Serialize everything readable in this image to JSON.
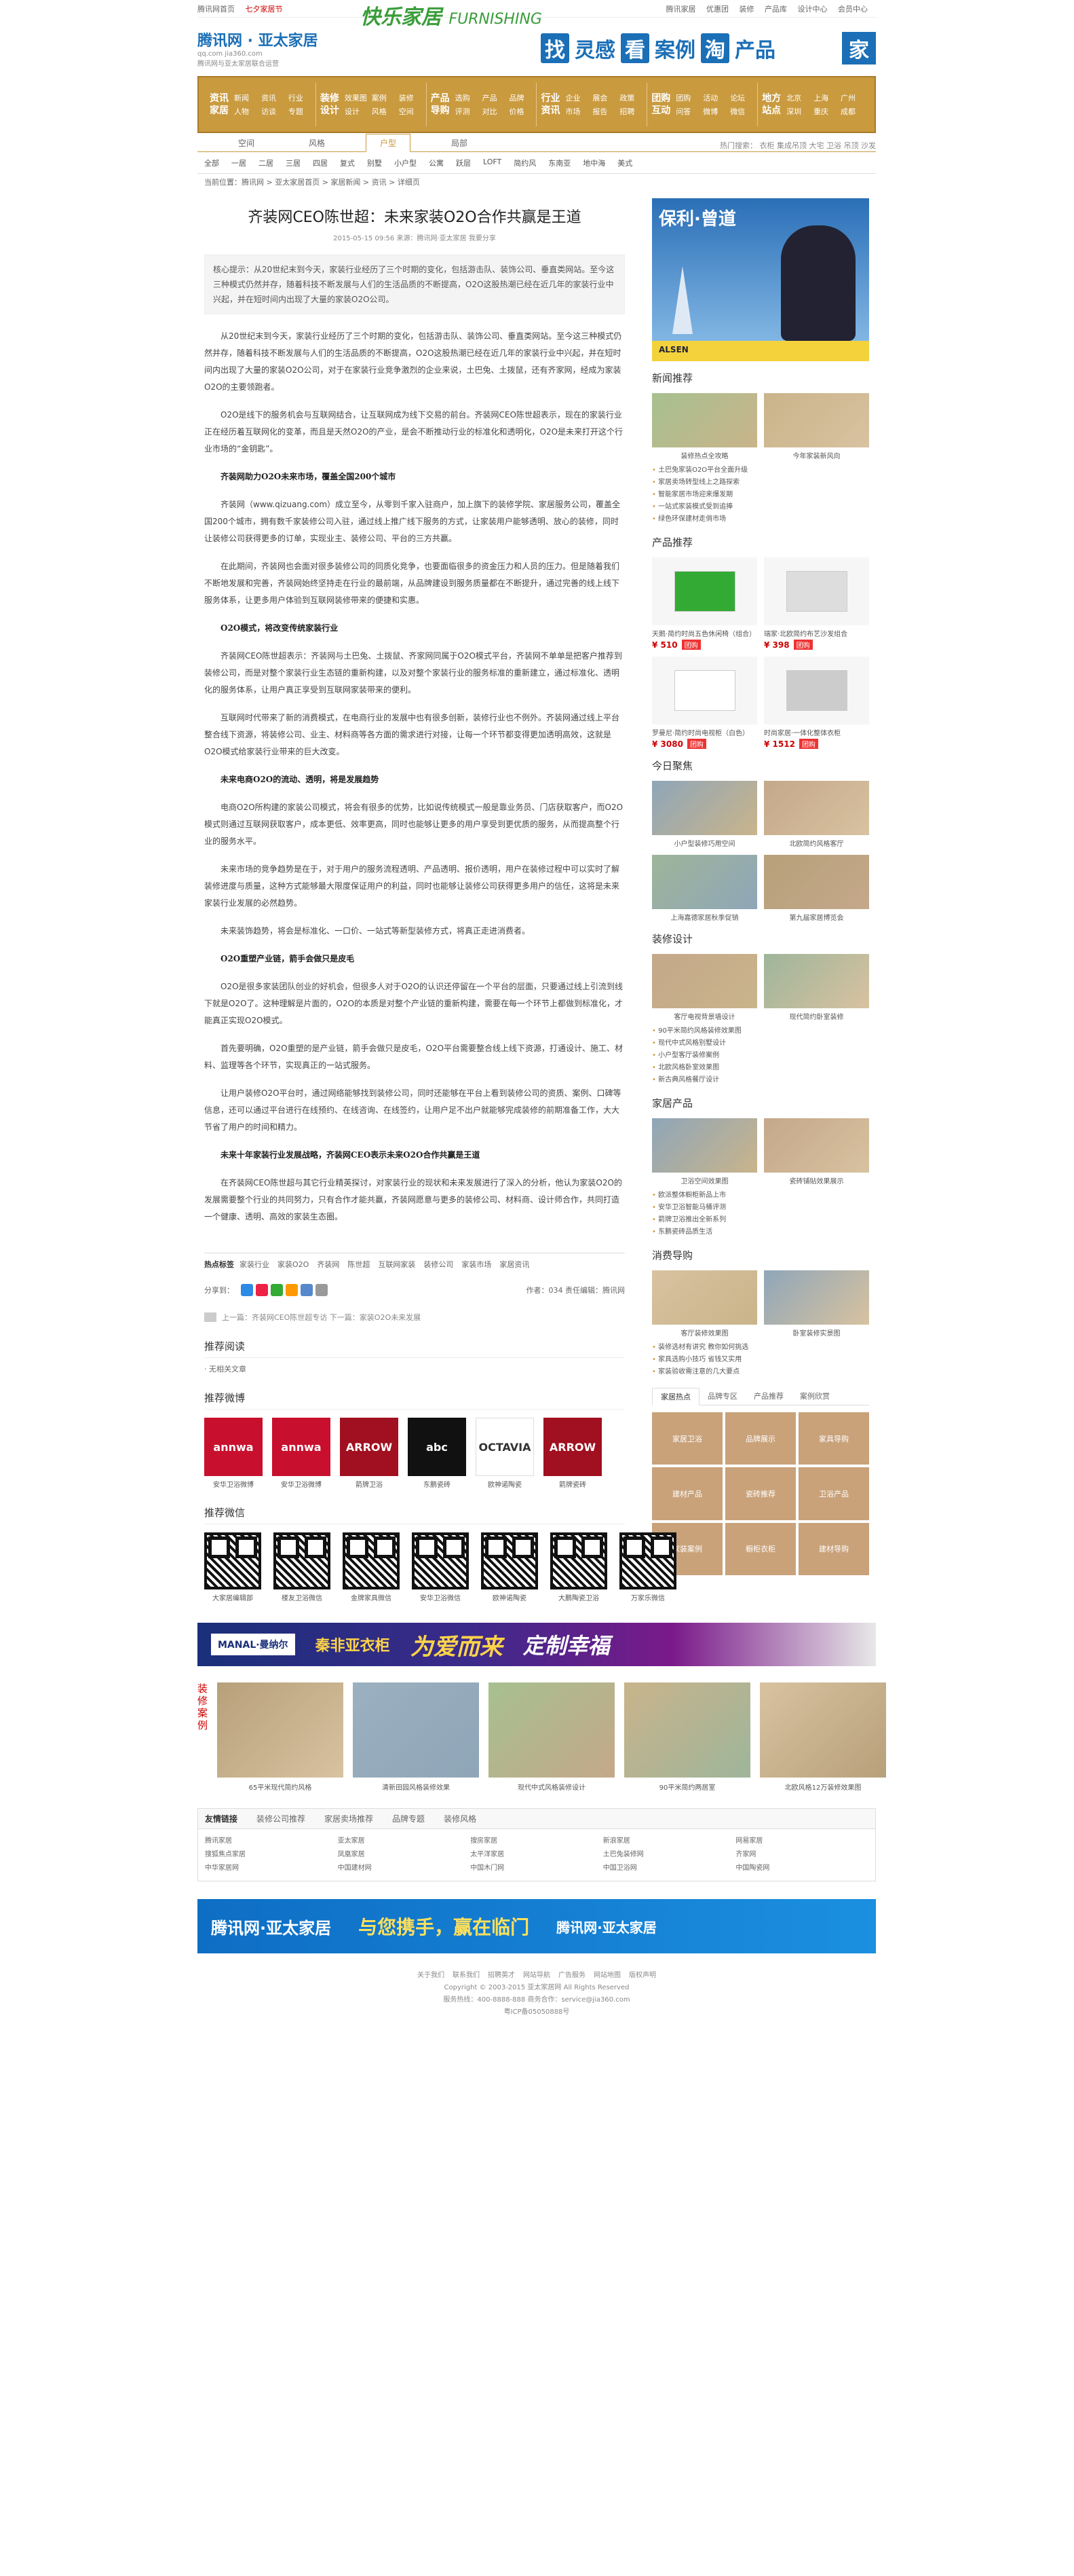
{
  "topbar": {
    "left": [
      "腾讯网首页",
      "七夕家居节"
    ],
    "slogan": "快乐家居",
    "slogan_en": "FURNISHING",
    "right": [
      "腾讯家居",
      "优惠团",
      "装修",
      "产品库",
      "设计中心",
      "会员中心"
    ]
  },
  "header": {
    "brand": "腾讯网 · 亚太家居",
    "brand_url": "qq.com  jia360.com",
    "sub": "腾讯网与亚太家居联合运营",
    "slogan_parts": [
      "找",
      "灵感",
      "看",
      "案例",
      "淘",
      "产品"
    ],
    "jia": "家"
  },
  "nav": [
    {
      "title": "资讯 家居",
      "links": [
        "新闻",
        "资讯",
        "行业",
        "人物",
        "访谈",
        "专题"
      ]
    },
    {
      "title": "装修 设计",
      "links": [
        "效果图",
        "案例",
        "装修",
        "设计",
        "风格",
        "空间"
      ]
    },
    {
      "title": "产品 导购",
      "links": [
        "选购",
        "产品",
        "品牌",
        "评测",
        "对比",
        "价格"
      ]
    },
    {
      "title": "行业 资讯",
      "links": [
        "企业",
        "展会",
        "政策",
        "市场",
        "报告",
        "招聘"
      ]
    },
    {
      "title": "团购 互动",
      "links": [
        "团购",
        "活动",
        "论坛",
        "问答",
        "微博",
        "微信"
      ]
    },
    {
      "title": "地方 站点",
      "links": [
        "北京",
        "上海",
        "广州",
        "深圳",
        "重庆",
        "成都"
      ]
    }
  ],
  "subnav": {
    "tabs": [
      "空间",
      "风格",
      "户型",
      "局部"
    ],
    "active_tab": "户型",
    "links": [
      "全部",
      "一居",
      "二居",
      "三居",
      "四居",
      "复式",
      "别墅",
      "小户型",
      "公寓",
      "跃层",
      "LOFT",
      "简约风",
      "东南亚",
      "地中海",
      "美式"
    ],
    "right": "热门搜索：  衣柜 集成吊顶 大宅 卫浴 吊顶 沙发"
  },
  "breadcrumb": "当前位置：腾讯网 > 亚太家居首页 > 家居新闻 > 资讯 > 详细页",
  "article": {
    "title": "齐装网CEO陈世超：未来家装O2O合作共赢是王道",
    "meta": "2015-05-15 09:56   来源：腾讯网·亚太家居   我要分享",
    "summary": "核心提示：从20世纪末到今天，家装行业经历了三个时期的变化，包括游击队、装饰公司、垂直类网站。至今这三种模式仍然并存，随着科技不断发展与人们的生活品质的不断提高，O2O这股热潮已经在近几年的家装行业中兴起，并在短时间内出现了大量的家装O2O公司。",
    "paragraphs": [
      {
        "sub": false,
        "text": "从20世纪末到今天，家装行业经历了三个时期的变化，包括游击队、装饰公司、垂直类网站。至今这三种模式仍然并存，随着科技不断发展与人们的生活品质的不断提高，O2O这股热潮已经在近几年的家装行业中兴起，并在短时间内出现了大量的家装O2O公司，对于在家装行业竞争激烈的企业来说，土巴兔、土拨鼠，还有齐家网，经成为家装O2O的主要领跑者。"
      },
      {
        "sub": false,
        "text": "O2O是线下的服务机会与互联网结合，让互联网成为线下交易的前台。齐装网CEO陈世超表示，现在的家装行业正在经历着互联网化的变革，而且是天然O2O的产业，是会不断推动行业的标准化和透明化，O2O是未来打开这个行业市场的“金钥匙”。"
      },
      {
        "sub": true,
        "text": "齐装网助力O2O未来市场，覆盖全国200个城市"
      },
      {
        "sub": false,
        "text": "齐装网（www.qizuang.com）成立至今，从零到千家入驻商户，加上旗下的装修学院、家居服务公司，覆盖全国200个城市，拥有数千家装修公司入驻，通过线上推广线下服务的方式，让家装用户能够透明、放心的装修，同时让装修公司获得更多的订单，实现业主、装修公司、平台的三方共赢。"
      },
      {
        "sub": false,
        "text": "在此期间，齐装网也会面对很多装修公司的同质化竞争，也要面临很多的资金压力和人员的压力。但是随着我们不断地发展和完善，齐装网始终坚持走在行业的最前端，从品牌建设到服务质量都在不断提升，通过完善的线上线下服务体系，让更多用户体验到互联网装修带来的便捷和实惠。"
      },
      {
        "sub": true,
        "text": "O2O模式，将改变传统家装行业"
      },
      {
        "sub": false,
        "text": "齐装网CEO陈世超表示：齐装网与土巴兔、土拨鼠、齐家网同属于O2O模式平台，齐装网不单单是把客户推荐到装修公司，而是对整个家装行业生态链的重新构建，以及对整个家装行业的服务标准的重新建立，通过标准化、透明化的服务体系，让用户真正享受到互联网家装带来的便利。"
      },
      {
        "sub": false,
        "text": "互联网时代带来了新的消费模式，在电商行业的发展中也有很多创新，装修行业也不例外。齐装网通过线上平台整合线下资源，将装修公司、业主、材料商等各方面的需求进行对接，让每一个环节都变得更加透明高效，这就是O2O模式给家装行业带来的巨大改变。"
      },
      {
        "sub": true,
        "text": "未来电商O2O的流动、透明，将是发展趋势"
      },
      {
        "sub": false,
        "text": "电商O2O所构建的家装公司模式，将会有很多的优势，比如说传统模式一般是靠业务员、门店获取客户，而O2O模式则通过互联网获取客户，成本更低、效率更高，同时也能够让更多的用户享受到更优质的服务，从而提高整个行业的服务水平。"
      },
      {
        "sub": false,
        "text": "未来市场的竞争趋势是在于，对于用户的服务流程透明、产品透明、报价透明，用户在装修过程中可以实时了解装修进度与质量，这种方式能够最大限度保证用户的利益，同时也能够让装修公司获得更多用户的信任，这将是未来家装行业发展的必然趋势。"
      },
      {
        "sub": false,
        "text": "未来装饰趋势，将会是标准化、一口价、一站式等新型装修方式，将真正走进消费者。"
      },
      {
        "sub": true,
        "text": "O2O重塑产业链，箭手会做只是皮毛"
      },
      {
        "sub": false,
        "text": "O2O是很多家装团队创业的好机会，但很多人对于O2O的认识还停留在一个平台的层面，只要通过线上引流到线下就是O2O了。这种理解是片面的，O2O的本质是对整个产业链的重新构建，需要在每一个环节上都做到标准化，才能真正实现O2O模式。"
      },
      {
        "sub": false,
        "text": "首先要明确，O2O重塑的是产业链，箭手会做只是皮毛，O2O平台需要整合线上线下资源，打通设计、施工、材料、监理等各个环节，实现真正的一站式服务。"
      },
      {
        "sub": false,
        "text": "让用户装修O2O平台时，通过网络能够找到装修公司，同时还能够在平台上看到装修公司的资质、案例、口碑等信息，还可以通过平台进行在线预约、在线咨询、在线签约，让用户足不出户就能够完成装修的前期准备工作，大大节省了用户的时间和精力。"
      },
      {
        "sub": true,
        "text": "未来十年家装行业发展战略，齐装网CEO表示未来O2O合作共赢是王道"
      },
      {
        "sub": false,
        "text": "在齐装网CEO陈世超与其它行业精英探讨，对家装行业的现状和未来发展进行了深入的分析，他认为家装O2O的发展需要整个行业的共同努力，只有合作才能共赢，齐装网愿意与更多的装修公司、材料商、设计师合作，共同打造一个健康、透明、高效的家装生态圈。"
      }
    ],
    "tags_label": "热点标签",
    "tags": [
      "家装行业",
      "家装O2O",
      "齐装网",
      "陈世超",
      "互联网家装",
      "装修公司",
      "家装市场",
      "家居资讯"
    ],
    "share_label": "分享到：",
    "share_right": "作者：034   责任编辑：腾讯网",
    "prevnext": "上一篇：齐装网CEO陈世超专访  下一篇：家装O2O未来发展",
    "rec_news_title": "推荐阅读",
    "rec_news_item": "· 无相关文章",
    "weibo_title": "推荐微博",
    "weibo": [
      {
        "name": "annwa",
        "sub": "安华卫浴微博",
        "color": "#c8102e"
      },
      {
        "name": "annwa",
        "sub": "安华卫浴微博",
        "color": "#c8102e"
      },
      {
        "name": "ARROW",
        "sub": "箭牌卫浴",
        "color": "#a01020"
      },
      {
        "name": "abc",
        "sub": "东鹏瓷砖",
        "color": "#111111"
      },
      {
        "name": "OCTAVIA",
        "sub": "欧神诺陶瓷",
        "color": "#ffffff"
      },
      {
        "name": "ARROW",
        "sub": "箭牌瓷砖",
        "color": "#a01020"
      }
    ],
    "wechat_title": "推荐微信",
    "wechat": [
      "大家居编辑部",
      "楼友卫浴微信",
      "金牌家具微信",
      "安华卫浴微信",
      "欧神诺陶瓷",
      "大鹏陶瓷卫浴",
      "万家乐微信"
    ]
  },
  "side": {
    "ad_title": "保利·曾道",
    "ad_bar": "ALSEN",
    "news_title": "新闻推荐",
    "news_thumbs": [
      "装修热点全攻略",
      "今年家装新风向"
    ],
    "news_list": [
      "土巴兔家装O2O平台全面升级",
      "家居卖场转型线上之路探索",
      "智能家居市场迎来爆发期",
      "一站式家装模式受到追捧",
      "绿色环保建材走俏市场"
    ],
    "prod_title": "产品推荐",
    "products": [
      {
        "name": "天鹅·简约时尚五色休闲椅（组合）",
        "price": "¥ 510",
        "badge": "团购"
      },
      {
        "name": "瑞家·北欧简约布艺沙发组合",
        "price": "¥ 398",
        "badge": "团购"
      },
      {
        "name": "罗曼尼·简约时尚电视柜（白色）",
        "price": "¥ 3080",
        "badge": "团购"
      },
      {
        "name": "时尚家居·一体化整体衣柜",
        "price": "¥ 1512",
        "badge": "团购"
      }
    ],
    "today_title": "今日聚焦",
    "today": [
      "小户型装修巧用空间",
      "北欧简约风格客厅",
      "上海嘉德家居秋季促销",
      "第九届家居博览会"
    ],
    "design_title": "装修设计",
    "design": [
      "客厅电视背景墙设计",
      "现代简约卧室装修"
    ],
    "design_list": [
      "90平米简约风格装修效果图",
      "现代中式风格别墅设计",
      "小户型客厅装修案例",
      "北欧风格卧室效果图",
      "新古典风格餐厅设计"
    ],
    "brand_title": "家居产品",
    "brand": [
      "卫浴空间效果图",
      "瓷砖铺贴效果展示"
    ],
    "brand_list": [
      "欧派整体橱柜新品上市",
      "安华卫浴智能马桶评测",
      "箭牌卫浴推出全新系列",
      "东鹏瓷砖品质生活"
    ],
    "shop_title": "消费导购",
    "shop": [
      "客厅装修效果图",
      "卧室装修实景图"
    ],
    "shop_list": [
      "装修选材有讲究 教你如何挑选",
      "家具选购小技巧 省钱又实用",
      "家装验收需注意的几大要点"
    ],
    "tabs": [
      "家居热点",
      "品牌专区",
      "产品推荐",
      "案例欣赏"
    ],
    "grid": [
      "家居卫浴",
      "品牌展示",
      "家具导购",
      "建材产品",
      "瓷砖推荐",
      "卫浴产品",
      "家装案例",
      "橱柜衣柜",
      "建材导购"
    ]
  },
  "banner": {
    "b1": "MANAL·曼纳尔",
    "b2": "秦非亚衣柜",
    "b3": "为爱而来",
    "b4": "定制幸福"
  },
  "gallery": {
    "label": "装修案例",
    "items": [
      "65平米现代简约风格",
      "清新田园风格装修效果",
      "现代中式风格装修设计",
      "90平米简约两居室",
      "北欧风格12万装修效果图"
    ]
  },
  "friends": {
    "tabs": [
      "友情链接",
      "装修公司推荐",
      "家居卖场推荐",
      "品牌专题",
      "装修风格"
    ],
    "links": [
      "腾讯家居",
      "亚太家居",
      "搜房家居",
      "新浪家居",
      "网易家居",
      "搜狐焦点家居",
      "凤凰家居",
      "太平洋家居",
      "土巴兔装修网",
      "齐家网",
      "中华家居网",
      "中国建材网",
      "中国木门网",
      "中国卫浴网",
      "中国陶瓷网"
    ]
  },
  "footban": {
    "f1": "腾讯网·亚太家居",
    "f2": "与您携手，赢在临门",
    "f3": "腾讯网·亚太家居"
  },
  "footer": {
    "links": [
      "关于我们",
      "联系我们",
      "招聘英才",
      "网站导航",
      "广告服务",
      "网站地图",
      "版权声明"
    ],
    "copyright": "Copyright © 2003-2015 亚太家居网 All Rights Reserved",
    "line2": "服务热线：400-8888-888  商务合作：service@jia360.com",
    "line3": "粤ICP备05050888号"
  },
  "colors": {
    "accent": "#c99a3e",
    "brand": "#1b6fb7",
    "price": "#cc0000"
  }
}
